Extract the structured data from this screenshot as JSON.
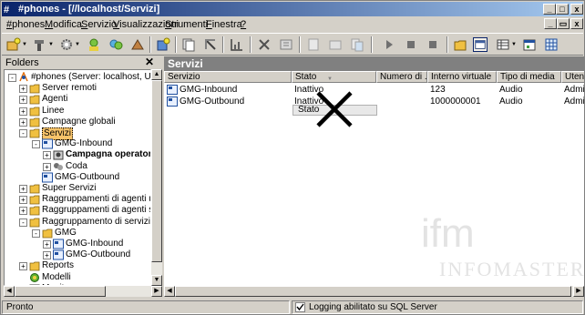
{
  "window": {
    "title": "#phones - [//localhost/Servizi]",
    "controls": [
      "minimize",
      "maximize",
      "close"
    ]
  },
  "menu": {
    "items": [
      {
        "label": "#phones",
        "underline": "#"
      },
      {
        "label": "Modifica",
        "underline": "M"
      },
      {
        "label": "Servizio",
        "underline": "S"
      },
      {
        "label": "Visualizzazioni",
        "underline": "V"
      },
      {
        "label": "Strumenti",
        "underline": "S"
      },
      {
        "label": "Finestra",
        "underline": "F"
      },
      {
        "label": "?",
        "underline": "?"
      }
    ]
  },
  "folders": {
    "title": "Folders",
    "close": "✕",
    "tree": [
      {
        "label": "#phones (Server: localhost, Utente: Administrator)",
        "icon": "phone-icon",
        "level": 0,
        "expander": "-"
      },
      {
        "label": "Server remoti",
        "icon": "folder-icon",
        "level": 1,
        "expander": "+"
      },
      {
        "label": "Agenti",
        "icon": "folder-icon",
        "level": 1,
        "expander": "+"
      },
      {
        "label": "Linee",
        "icon": "folder-icon",
        "level": 1,
        "expander": "+"
      },
      {
        "label": "Campagne globali",
        "icon": "folder-icon",
        "level": 1,
        "expander": "+"
      },
      {
        "label": "Servizi",
        "icon": "folder-open-icon",
        "level": 1,
        "expander": "-",
        "selected": true
      },
      {
        "label": "GMG-Inbound",
        "icon": "service-icon",
        "level": 2,
        "expander": "-"
      },
      {
        "label": "Campagna operatore",
        "icon": "campaign-icon",
        "level": 3,
        "expander": "+",
        "bold": true
      },
      {
        "label": "Coda",
        "icon": "queue-icon",
        "level": 3,
        "expander": "+"
      },
      {
        "label": "GMG-Outbound",
        "icon": "service-icon",
        "level": 2,
        "expander": ""
      },
      {
        "label": "Super Servizi",
        "icon": "folder-icon",
        "level": 1,
        "expander": "+"
      },
      {
        "label": "Raggruppamenti di agenti umani",
        "icon": "folder-icon",
        "level": 1,
        "expander": "+"
      },
      {
        "label": "Raggruppamenti di agenti sintetici",
        "icon": "folder-icon",
        "level": 1,
        "expander": "+"
      },
      {
        "label": "Raggruppamento di servizi",
        "icon": "folder-icon",
        "level": 1,
        "expander": "-"
      },
      {
        "label": "GMG",
        "icon": "folder-icon",
        "level": 2,
        "expander": "-"
      },
      {
        "label": "GMG-Inbound",
        "icon": "service-icon",
        "level": 3,
        "expander": "+"
      },
      {
        "label": "GMG-Outbound",
        "icon": "service-icon",
        "level": 3,
        "expander": "+"
      },
      {
        "label": "Reports",
        "icon": "folder-icon",
        "level": 1,
        "expander": "+"
      },
      {
        "label": "Modelli",
        "icon": "models-icon",
        "level": 1,
        "expander": ""
      },
      {
        "label": "Monitor",
        "icon": "monitor-icon",
        "level": 1,
        "expander": ""
      }
    ]
  },
  "pane": {
    "title": "Servizi",
    "columns": [
      "Servizio",
      "Stato",
      "Numero di ...",
      "Interno virtuale",
      "Tipo di media",
      "Utente"
    ],
    "rows": [
      [
        "GMG-Inbound",
        "Inattivo",
        "",
        "123",
        "Audio",
        "Administrator"
      ],
      [
        "GMG-Outbound",
        "Inattivo",
        "",
        "1000000001",
        "Audio",
        "Administrator"
      ]
    ],
    "drag_tooltip": "Stato"
  },
  "watermark": {
    "logo": "ifm",
    "text": "INFOMASTER"
  },
  "status": {
    "left": "Pronto",
    "middle": "Logging abilitato su SQL Server"
  },
  "colors": {
    "titlebar_start": "#0a246a",
    "titlebar_end": "#a6caf0",
    "selection": "#f7c36a",
    "pane_header": "#808080"
  }
}
